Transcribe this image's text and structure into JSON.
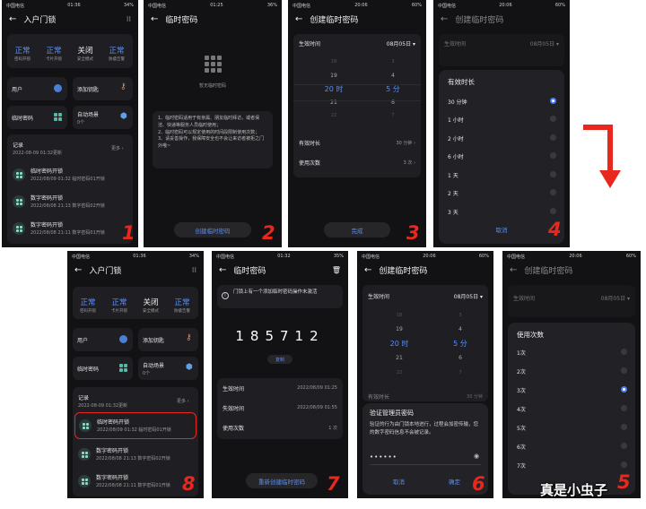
{
  "p1": {
    "status": {
      "left": "中国电信",
      "mid": "01:36",
      "right": "34%"
    },
    "title": "入户门锁",
    "stats": [
      {
        "value": "正常",
        "label": "密码开锁"
      },
      {
        "value": "正常",
        "label": "卡片开锁"
      },
      {
        "value": "关闭",
        "label": "安全模式"
      },
      {
        "value": "正常",
        "label": "防撬告警"
      }
    ],
    "tiles": {
      "user": "用户",
      "add_key": "添加钥匙",
      "temp_pw": "临时密码",
      "auto_scene": "自动场景",
      "auto_scene_sub": "0个"
    },
    "records": {
      "title": "记录",
      "date": "2022-08-09 01:32更新",
      "more": "更多",
      "items": [
        {
          "title": "临时密码开锁",
          "sub": "2022/08/09 01:32 临时密码01开锁"
        },
        {
          "title": "数字密码开锁",
          "sub": "2022/08/08 21:13 数字密码02开锁"
        },
        {
          "title": "数字密码开锁",
          "sub": "2022/08/08 21:11 数字密码01开锁"
        }
      ]
    },
    "step": "1"
  },
  "p2": {
    "status": {
      "left": "中国电信",
      "mid": "01:25",
      "right": "36%"
    },
    "title": "临时密码",
    "empty_text": "暂无临时密码",
    "note": "1、临时密码适用于有亲属、朋友临时拜访，或者保洁、快递等服务人员临时使用；\n2、临时密码可以规定使用的时间段限制使用次数；\n3、请妥善操作，我保障安全也不会让来访者被拒之门外哦~",
    "button": "创建临时密码",
    "step": "2"
  },
  "p3": {
    "status": {
      "left": "中国电信",
      "mid": "20:06",
      "right": "60%"
    },
    "title": "创建临时密码",
    "start_label": "生效时间",
    "start_value": "08月05日",
    "picker_hours": [
      "18",
      "19",
      "20 时",
      "21",
      "22"
    ],
    "picker_mins": [
      "3",
      "4",
      "5 分",
      "6",
      "7"
    ],
    "duration_label": "有效时长",
    "duration_value": "30 分钟",
    "uses_label": "使用次数",
    "uses_value": "3 次",
    "button": "完成",
    "step": "3"
  },
  "p4": {
    "status": {
      "left": "中国电信",
      "mid": "20:06",
      "right": "60%"
    },
    "title": "创建临时密码",
    "start_label": "生效时间",
    "start_value": "08月05日",
    "sheet_title": "有效时长",
    "options": [
      "30 分钟",
      "1 小时",
      "2 小时",
      "6 小时",
      "1 天",
      "2 天",
      "3 天"
    ],
    "cancel": "取消",
    "step": "4"
  },
  "p8": {
    "status": {
      "left": "中国电信",
      "mid": "01:36",
      "right": "34%"
    },
    "title": "入户门锁",
    "stats": [
      {
        "value": "正常",
        "label": "密码开锁"
      },
      {
        "value": "正常",
        "label": "卡片开锁"
      },
      {
        "value": "关闭",
        "label": "安全模式"
      },
      {
        "value": "正常",
        "label": "防撬告警"
      }
    ],
    "tiles": {
      "user": "用户",
      "add_key": "添加钥匙",
      "temp_pw": "临时密码",
      "auto_scene": "自动场景",
      "auto_scene_sub": "0个"
    },
    "records": {
      "title": "记录",
      "date": "2022-08-09 01:32更新",
      "more": "更多",
      "items": [
        {
          "title": "临时密码开锁",
          "sub": "2022/08/09 01:32 临时密码01开锁"
        },
        {
          "title": "数字密码开锁",
          "sub": "2022/08/08 21:13 数字密码02开锁"
        },
        {
          "title": "数字密码开锁",
          "sub": "2022/08/08 21:11 数字密码01开锁"
        }
      ]
    },
    "step": "8"
  },
  "p7": {
    "status": {
      "left": "中国电信",
      "mid": "01:32",
      "right": "35%"
    },
    "title": "临时密码",
    "info": "门锁上有一个添加临时密码操作未激活",
    "code": "185712",
    "copy": "复制",
    "rows": [
      {
        "label": "生效时间",
        "value": "2022/08/09 01:25"
      },
      {
        "label": "失效时间",
        "value": "2022/08/09 01:55"
      },
      {
        "label": "使用次数",
        "value": "1 次"
      }
    ],
    "button": "重新创建临时密码",
    "step": "7"
  },
  "p6": {
    "status": {
      "left": "中国电信",
      "mid": "20:06",
      "right": "60%"
    },
    "title": "创建临时密码",
    "start_label": "生效时间",
    "start_value": "08月05日",
    "picker_hours": [
      "18",
      "19",
      "20 时",
      "21",
      "22"
    ],
    "picker_mins": [
      "3",
      "4",
      "5 分",
      "6",
      "7"
    ],
    "duration_label": "有效时长",
    "duration_value": "30 分钟",
    "dialog_title": "验证管理员密码",
    "dialog_body": "验证的行为由门锁本地进行，过程会加密传输，您的数字密码信息不会被记录。",
    "password": "••••••",
    "cancel": "取消",
    "confirm": "确定",
    "step": "6"
  },
  "p5": {
    "status": {
      "left": "中国电信",
      "mid": "20:06",
      "right": "60%"
    },
    "title": "创建临时密码",
    "start_label": "生效时间",
    "start_value": "08月05日",
    "sheet_title": "使用次数",
    "options": [
      "1次",
      "2次",
      "3次",
      "4次",
      "5次",
      "6次",
      "7次"
    ],
    "step": "5"
  },
  "watermark": "真是小虫子",
  "accent": "#5b8df5",
  "step_color": "#e8281f"
}
